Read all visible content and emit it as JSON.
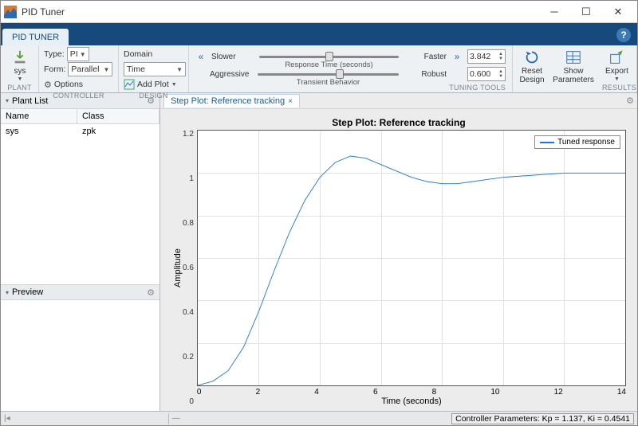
{
  "window": {
    "title": "PID Tuner"
  },
  "tabstrip": {
    "tab": "PID TUNER"
  },
  "ribbon": {
    "plant": {
      "btn": "sys",
      "section": "PLANT"
    },
    "controller": {
      "type_label": "Type:",
      "type_value": "PI",
      "form_label": "Form:",
      "form_value": "Parallel",
      "options": "Options",
      "section": "CONTROLLER"
    },
    "design": {
      "domain_label": "Domain",
      "domain_value": "Time",
      "addplot": "Add Plot",
      "section": "DESIGN"
    },
    "tuning": {
      "s1_left": "Slower",
      "s1_cap": "Response Time (seconds)",
      "s1_right": "Faster",
      "s1_val": "3.842",
      "s2_left": "Aggressive",
      "s2_cap": "Transient Behavior",
      "s2_right": "Robust",
      "s2_val": "0.600",
      "section": "TUNING TOOLS"
    },
    "reset": "Reset Design",
    "showparams": "Show Parameters",
    "export": "Export",
    "results": "RESULTS"
  },
  "panels": {
    "plantlist": "Plant List",
    "col_name": "Name",
    "col_class": "Class",
    "row_name": "sys",
    "row_class": "zpk",
    "preview": "Preview"
  },
  "plot": {
    "tab": "Step Plot: Reference tracking",
    "title": "Step Plot: Reference tracking",
    "legend": "Tuned response",
    "xlabel": "Time (seconds)",
    "ylabel": "Amplitude",
    "xticks": [
      "0",
      "2",
      "4",
      "6",
      "8",
      "10",
      "12",
      "14"
    ],
    "yticks": [
      "1.2",
      "1",
      "0.8",
      "0.6",
      "0.4",
      "0.2",
      "0"
    ]
  },
  "chart_data": {
    "type": "line",
    "title": "Step Plot: Reference tracking",
    "xlabel": "Time (seconds)",
    "ylabel": "Amplitude",
    "xlim": [
      0,
      14
    ],
    "ylim": [
      0,
      1.2
    ],
    "series": [
      {
        "name": "Tuned response",
        "x": [
          0,
          0.5,
          1,
          1.5,
          2,
          2.5,
          3,
          3.5,
          4,
          4.5,
          5,
          5.5,
          6,
          6.5,
          7,
          7.5,
          8,
          8.5,
          9,
          9.5,
          10,
          11,
          12,
          13,
          14
        ],
        "y": [
          0,
          0.02,
          0.07,
          0.18,
          0.35,
          0.54,
          0.72,
          0.87,
          0.98,
          1.05,
          1.08,
          1.07,
          1.04,
          1.01,
          0.98,
          0.96,
          0.95,
          0.95,
          0.96,
          0.97,
          0.98,
          0.99,
          1.0,
          1.0,
          1.0
        ]
      }
    ]
  },
  "status": {
    "params": "Controller Parameters: Kp = 1.137, Ki = 0.4541"
  }
}
